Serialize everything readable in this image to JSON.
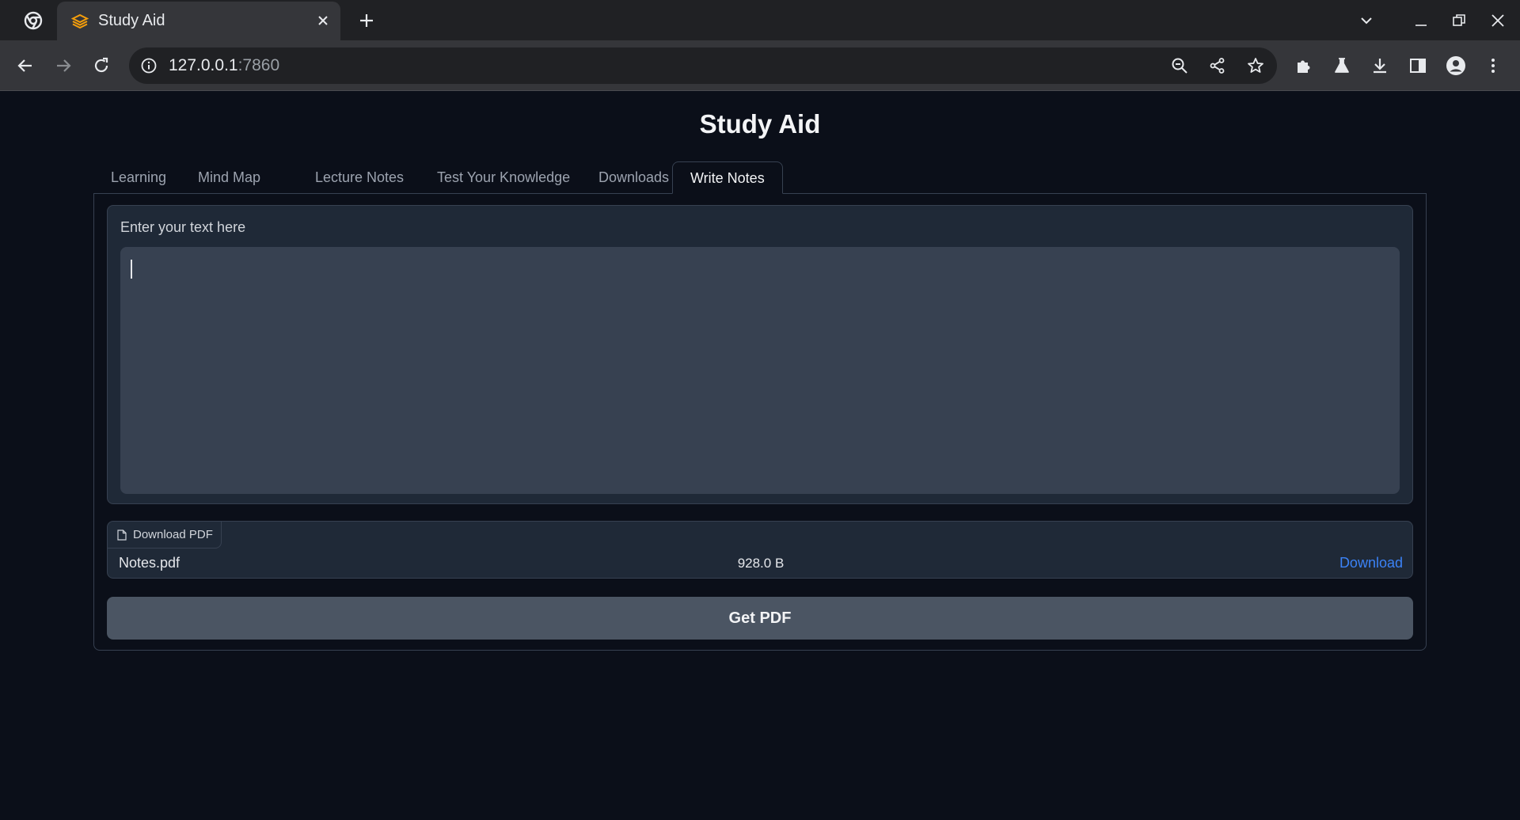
{
  "browser": {
    "tab_title": "Study Aid",
    "url_host": "127.0.0.1",
    "url_port": ":7860"
  },
  "app": {
    "title": "Study Aid",
    "tabs": [
      {
        "label": "Learning"
      },
      {
        "label": "Mind Map"
      },
      {
        "label": "Lecture Notes"
      },
      {
        "label": "Test Your Knowledge"
      },
      {
        "label": "Downloads"
      },
      {
        "label": "Write Notes",
        "selected": true
      }
    ],
    "textbox": {
      "label": "Enter your text here",
      "value": ""
    },
    "file": {
      "label": "Download PDF",
      "name": "Notes.pdf",
      "size": "928.0 B",
      "download_label": "Download"
    },
    "get_pdf_label": "Get PDF"
  },
  "icons": {
    "favicon": "layers-icon",
    "accent": "#f59e0b",
    "link_color": "#3b82f6"
  }
}
